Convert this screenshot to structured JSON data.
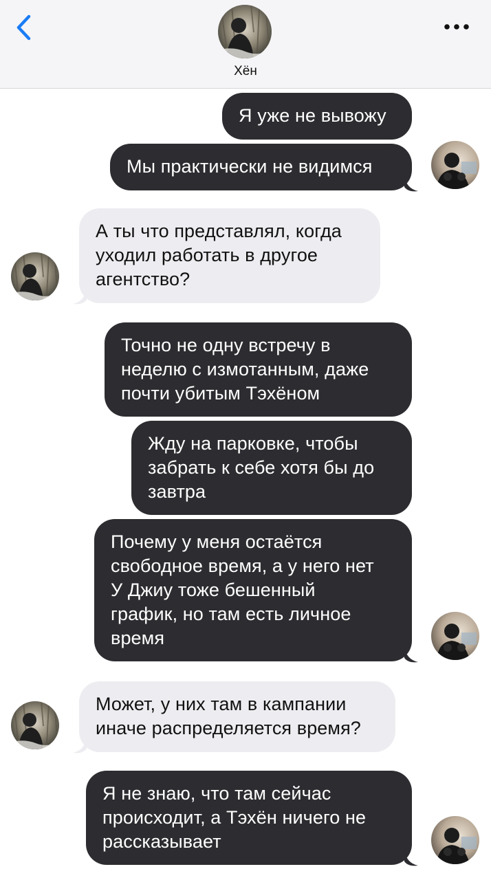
{
  "header": {
    "contact_name": "Хён",
    "back_icon": "chevron-left-icon",
    "more_icon": "ellipsis-icon"
  },
  "colors": {
    "accent": "#1a7cf5",
    "outgoing_bubble": "#2d2c30",
    "incoming_bubble": "#ededf1"
  },
  "messages": [
    {
      "direction": "outgoing",
      "lines": [
        "Я уже не вывожу"
      ]
    },
    {
      "direction": "outgoing",
      "lines": [
        "Мы практически не видимся"
      ]
    },
    {
      "direction": "incoming",
      "lines": [
        "А ты что представлял, когда",
        "уходил работать в другое",
        "агентство?"
      ]
    },
    {
      "direction": "outgoing",
      "lines": [
        "Точно не одну встречу в",
        "неделю с измотанным, даже",
        "почти убитым Тэхёном"
      ]
    },
    {
      "direction": "outgoing",
      "lines": [
        "Жду на парковке, чтобы",
        "забрать к себе хотя бы до",
        "завтра"
      ]
    },
    {
      "direction": "outgoing",
      "lines": [
        "Почему у меня остаётся",
        "свободное время, а у него нет",
        "У Джиу тоже бешенный",
        "график, но там есть личное",
        "время"
      ]
    },
    {
      "direction": "incoming",
      "lines": [
        "Может, у них там в кампании",
        "иначе распределяется время?"
      ]
    },
    {
      "direction": "outgoing",
      "lines": [
        "Я не знаю, что там сейчас",
        "происходит, а Тэхён ничего не",
        "рассказывает"
      ]
    }
  ]
}
